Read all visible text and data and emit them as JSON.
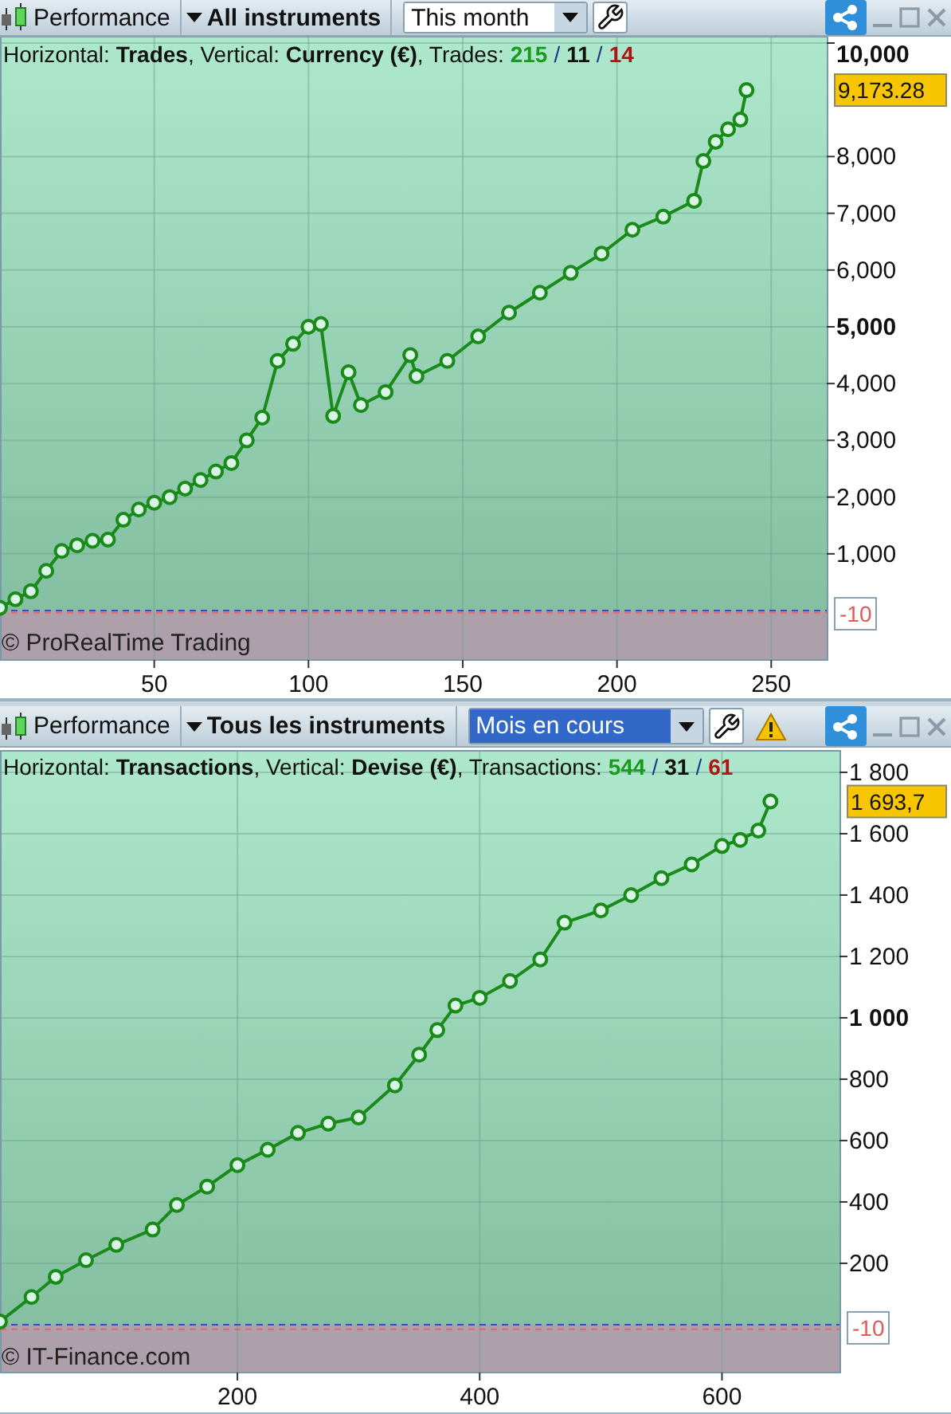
{
  "panels": [
    {
      "toolbar": {
        "performance": "Performance",
        "instruments": "All instruments",
        "period": {
          "value": "This month",
          "highlighted": false
        },
        "warning": false
      },
      "header": {
        "text": "Horizontal: **Trades**, Vertical: **Currency (€)**, Trades:",
        "separator": "/",
        "counts": [
          {
            "value": "215",
            "color": "#1a9a1a"
          },
          {
            "value": "11",
            "color": "#111111"
          },
          {
            "value": "14",
            "color": "#b01414"
          }
        ]
      },
      "copyright": "© ProRealTime Trading",
      "last_value": "9,173.28",
      "baseline_label": "-10",
      "chart_data": {
        "type": "line",
        "xlim": [
          0,
          268
        ],
        "ylim": [
          -870,
          10112
        ],
        "xticks": [
          50,
          100,
          150,
          200,
          250
        ],
        "yticks": [
          {
            "value": 1000,
            "label": "1,000"
          },
          {
            "value": 2000,
            "label": "2,000"
          },
          {
            "value": 3000,
            "label": "3,000"
          },
          {
            "value": 4000,
            "label": "4,000"
          },
          {
            "value": 5000,
            "label": "5,000"
          },
          {
            "value": 6000,
            "label": "6,000"
          },
          {
            "value": 7000,
            "label": "7,000"
          },
          {
            "value": 8000,
            "label": "8,000"
          },
          {
            "value": 10000,
            "label": "10,000"
          }
        ],
        "grid": true,
        "ref_lines": [
          {
            "axis": "y",
            "value": 0,
            "color": "#3050c0"
          },
          {
            "axis": "y",
            "value": -10,
            "color": "#e06a6a"
          }
        ],
        "x": [
          0,
          5,
          10,
          15,
          20,
          25,
          30,
          35,
          40,
          45,
          50,
          55,
          60,
          65,
          70,
          75,
          80,
          85,
          90,
          95,
          100,
          104,
          108,
          113,
          117,
          125,
          133,
          135,
          145,
          155,
          165,
          175,
          185,
          195,
          205,
          215,
          225,
          228,
          232,
          236,
          240,
          242
        ],
        "series": [
          {
            "color": "#1a8a1a",
            "marker": "o",
            "values": [
              50,
              200,
              340,
              700,
              1050,
              1150,
              1230,
              1250,
              1600,
              1780,
              1900,
              2000,
              2150,
              2300,
              2450,
              2600,
              3000,
              3400,
              4400,
              4700,
              5000,
              5050,
              3430,
              4200,
              3620,
              3850,
              4500,
              4130,
              4400,
              4830,
              5250,
              5600,
              5950,
              6290,
              6710,
              6940,
              7220,
              7920,
              8260,
              8480,
              8650,
              9170
            ]
          }
        ]
      }
    },
    {
      "toolbar": {
        "performance": "Performance",
        "instruments": "Tous les instruments",
        "period": {
          "value": "Mois en cours",
          "highlighted": true
        },
        "warning": true
      },
      "header": {
        "text": "Horizontal: **Transactions**, Vertical: **Devise (€)**, Transactions:",
        "separator": "/",
        "counts": [
          {
            "value": "544",
            "color": "#1a9a1a"
          },
          {
            "value": "31",
            "color": "#111111"
          },
          {
            "value": "61",
            "color": "#b01414"
          }
        ]
      },
      "copyright": "© IT-Finance.com",
      "last_value": "1 693,7",
      "baseline_label": "-10",
      "chart_data": {
        "type": "line",
        "xlim": [
          4,
          697
        ],
        "ylim": [
          -156,
          1870
        ],
        "xticks": [
          200,
          400,
          600
        ],
        "yticks": [
          {
            "value": 200,
            "label": "200"
          },
          {
            "value": 400,
            "label": "400"
          },
          {
            "value": 600,
            "label": "600"
          },
          {
            "value": 800,
            "label": "800"
          },
          {
            "value": 1000,
            "label": "1 000"
          },
          {
            "value": 1200,
            "label": "1 200"
          },
          {
            "value": 1400,
            "label": "1 400"
          },
          {
            "value": 1600,
            "label": "1 600"
          },
          {
            "value": 1800,
            "label": "1 800"
          }
        ],
        "grid": true,
        "ref_lines": [
          {
            "axis": "y",
            "value": 0,
            "color": "#3050c0"
          },
          {
            "axis": "y",
            "value": -10,
            "color": "#e06a6a"
          }
        ],
        "x": [
          4,
          30,
          50,
          75,
          100,
          130,
          150,
          175,
          200,
          225,
          250,
          275,
          300,
          330,
          350,
          365,
          380,
          400,
          425,
          450,
          470,
          500,
          525,
          550,
          575,
          600,
          615,
          630,
          640
        ],
        "series": [
          {
            "color": "#1a8a1a",
            "marker": "o",
            "values": [
              10,
              90,
              156,
              210,
              260,
              310,
              390,
              450,
              520,
              570,
              625,
              655,
              675,
              780,
              880,
              960,
              1040,
              1065,
              1120,
              1190,
              1310,
              1350,
              1400,
              1455,
              1500,
              1560,
              1580,
              1610,
              1705
            ]
          }
        ]
      }
    }
  ]
}
